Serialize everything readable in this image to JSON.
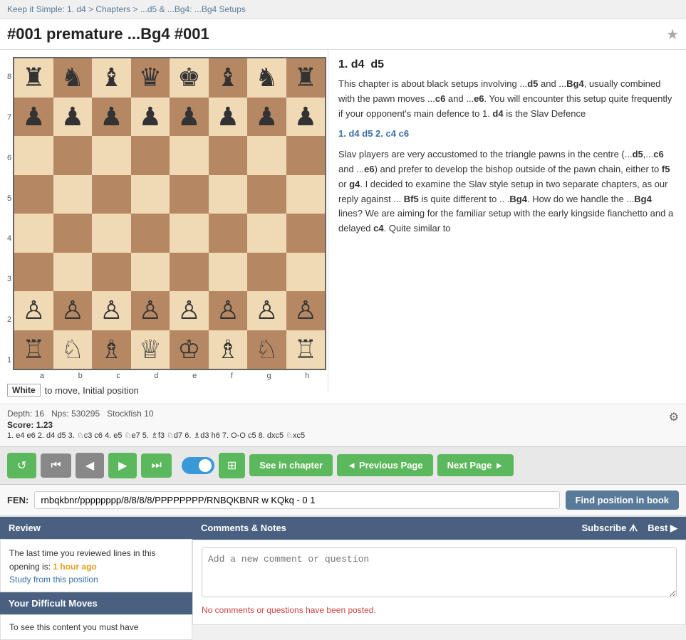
{
  "breadcrumb": {
    "items": [
      {
        "label": "Keep it Simple: 1. d4",
        "href": "#"
      },
      {
        "label": "Chapters",
        "href": "#"
      },
      {
        "label": "...d5 & ...Bg4: ...Bg4 Setups",
        "href": "#"
      }
    ],
    "separator": ">"
  },
  "page": {
    "title": "#001 premature ...Bg4 #001",
    "star_icon": "★"
  },
  "chess": {
    "status_badge": "White",
    "status_text": "to move, Initial position",
    "board": [
      [
        "♜",
        "♞",
        "♝",
        "♛",
        "♚",
        "♝",
        "♞",
        "♜"
      ],
      [
        "♟",
        "♟",
        "♟",
        "♟",
        "♟",
        "♟",
        "♟",
        "♟"
      ],
      [
        "",
        "",
        "",
        "",
        "",
        "",
        "",
        ""
      ],
      [
        "",
        "",
        "",
        "",
        "",
        "",
        "",
        ""
      ],
      [
        "",
        "",
        "",
        "",
        "",
        "",
        "",
        ""
      ],
      [
        "",
        "",
        "",
        "",
        "",
        "",
        "",
        ""
      ],
      [
        "♙",
        "♙",
        "♙",
        "♙",
        "♙",
        "♙",
        "♙",
        "♙"
      ],
      [
        "♖",
        "♘",
        "♗",
        "♕",
        "♔",
        "♗",
        "♘",
        "♖"
      ]
    ],
    "rank_labels": [
      "8",
      "7",
      "6",
      "5",
      "4",
      "3",
      "2",
      "1"
    ],
    "file_labels": [
      "a",
      "b",
      "c",
      "d",
      "e",
      "f",
      "g",
      "h"
    ]
  },
  "text_panel": {
    "move_header": "1. d4  d5",
    "paragraphs": [
      "This chapter is about black setups involving ...d5 and ...Bg4, usually combined with the pawn moves ...c6 and ...e6. You will encounter this setup quite frequently if your opponent's main defence to 1. d4 is the Slav Defence",
      "1. d4 d5 2. c4 c6",
      "Slav players are very accustomed to the triangle pawns in the centre (...d5,...c6 and ...e6) and prefer to develop the bishop outside of the pawn chain, either to f5 or g4. I decided to examine the Slav style setup in two separate chapters, as our reply against ... Bf5 is quite different to .. .Bg4. How do we handle the ...Bg4 lines? We are aiming for the familiar setup with the early kingside fianchetto and a delayed c4. Quite similar to"
    ],
    "move_link": "1. d4 d5 2. c4 c6"
  },
  "engine": {
    "depth_label": "Depth: 16",
    "nps_label": "Nps: 530295",
    "engine_name": "Stockfish 10",
    "score_label": "Score:",
    "score_value": "1.23",
    "line": "1. e4 e6 2. d4 d5 3. ♘c3 c6 4. e5 ♘e7 5. ♗f3 ♘d7 6. ♗d3 h6 7. O-O c5 8. dxc5 ♘xc5",
    "gear_icon": "⚙"
  },
  "controls": {
    "restart_icon": "↺",
    "first_icon": "⏮",
    "prev_icon": "◀",
    "next_icon": "▶",
    "last_icon": "⏭",
    "see_chapter_label": "See in chapter",
    "prev_page_label": "◄ Previous Page",
    "next_page_label": "Next Page ►"
  },
  "fen": {
    "label": "FEN:",
    "value": "rnbqkbnr/pppppppp/8/8/8/8/PPPPPPPP/RNBQKBNR w KQkq - 0 1",
    "find_button": "Find position in book"
  },
  "review": {
    "header": "Review",
    "text1": "The last time you reviewed lines in this opening is:",
    "time": "1 hour ago",
    "study_link": "Study from this position"
  },
  "difficult_moves": {
    "header": "Your Difficult Moves",
    "text": "To see this content you must have"
  },
  "comments": {
    "header": "Comments & Notes",
    "subscribe_label": "Subscribe ᗑ",
    "best_label": "Best ▶",
    "placeholder": "Add a new comment or question",
    "no_comments": "No comments or questions have been posted."
  }
}
